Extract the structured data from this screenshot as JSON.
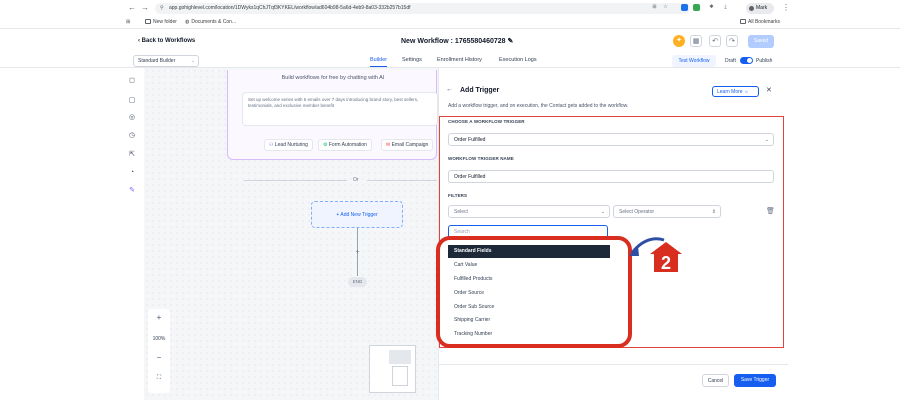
{
  "browser": {
    "url": "app.gohighlevel.com/location/1DWyks1qChJTqf3KYKEL/workflow/ad604b98-5a6d-4eb9-8a03-332b257b15df",
    "profile": "Mark",
    "all_bookmarks": "All Bookmarks",
    "bookmarks": [
      "New folder",
      "Documents & Con..."
    ]
  },
  "header": {
    "back_label": "Back to Workflows",
    "title": "New Workflow : 1765580460728",
    "save_label": "Saved"
  },
  "subheader": {
    "builder_select": "Standard Builder",
    "tabs": [
      "Builder",
      "Settings",
      "Enrollment History",
      "Execution Logs"
    ],
    "test_workflow": "Test Workflow",
    "draft": "Draft",
    "publish": "Publish"
  },
  "canvas": {
    "ai_title": "Build workflows for free by chatting with AI",
    "ai_prompt": "Set up welcome series with 5 emails over 7 days introducing brand story, best sellers, testimonials, and exclusive member benefit",
    "chips": [
      "Lead Nurturing",
      "Form Automation",
      "Email Campaign"
    ],
    "or": "Or",
    "add_trigger": "Add New Trigger",
    "end": "END",
    "zoom": "100%"
  },
  "panel": {
    "title": "Add Trigger",
    "subtitle": "Add a workflow trigger, and on execution, the Contact gets added to the workflow.",
    "learn_more": "Learn More",
    "choose_label": "CHOOSE A WORKFLOW TRIGGER",
    "choose_value": "Order Fulfilled",
    "name_label": "WORKFLOW TRIGGER NAME",
    "name_value": "Order Fulfilled",
    "filters_label": "FILTERS",
    "select_placeholder": "Select",
    "operator_placeholder": "Select Operator",
    "search_placeholder": "Search",
    "dropdown_items": [
      "Standard Fields",
      "Cart Value",
      "Fulfilled Products",
      "Order Source",
      "Order Sub Source",
      "Shipping Carrier",
      "Tracking Number"
    ],
    "cancel": "Cancel",
    "save_trigger": "Save Trigger"
  },
  "annotation": {
    "step_number": "2",
    "color": "#d92d20"
  }
}
